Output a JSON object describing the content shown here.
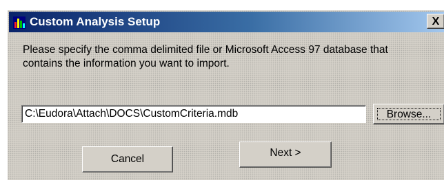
{
  "window": {
    "title": "Custom Analysis Setup",
    "close_label": "X",
    "app_icon": "bar-chart-icon"
  },
  "message": {
    "line1": "Please specify the comma delimited file or Microsoft Access 97 database that",
    "line2": "contains the information you want to import."
  },
  "file_path": {
    "value": "C:\\Eudora\\Attach\\DOCS\\CustomCriteria.mdb"
  },
  "buttons": {
    "browse": "Browse...",
    "cancel": "Cancel",
    "next": "Next >"
  },
  "colors": {
    "titlebar_start": "#0a246a",
    "titlebar_end": "#a6caf0",
    "dialog_face": "#d4d0c8"
  }
}
